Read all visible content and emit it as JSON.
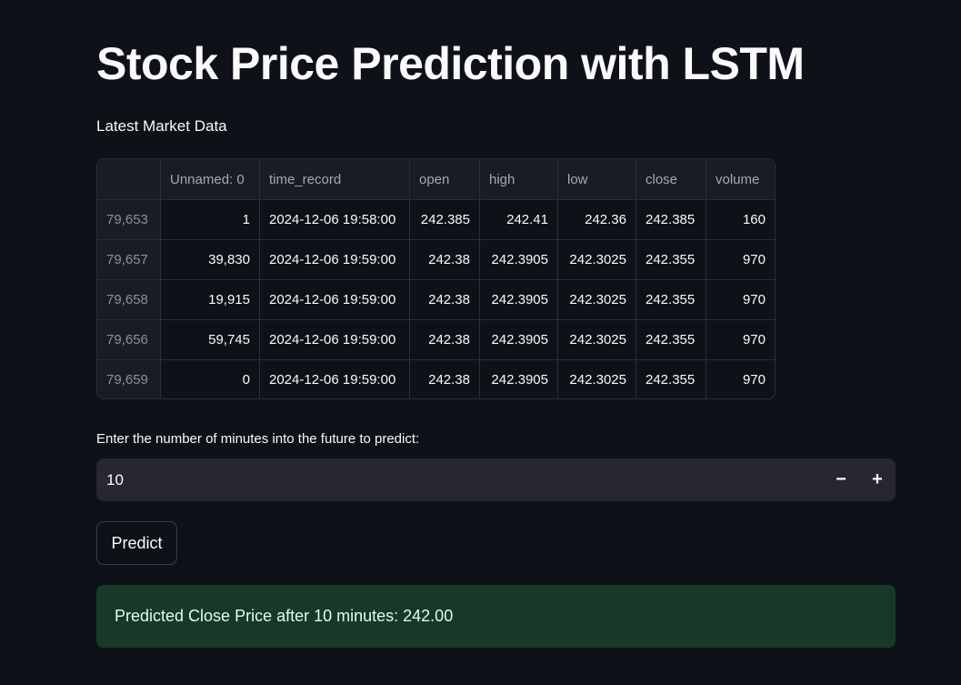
{
  "page": {
    "title": "Stock Price Prediction with LSTM",
    "subheading": "Latest Market Data"
  },
  "table": {
    "columns": [
      "",
      "Unnamed: 0",
      "time_record",
      "open",
      "high",
      "low",
      "close",
      "volume"
    ],
    "rows": [
      {
        "index": "79,653",
        "unnamed": "1",
        "time_record": "2024-12-06 19:58:00",
        "open": "242.385",
        "high": "242.41",
        "low": "242.36",
        "close": "242.385",
        "volume": "160"
      },
      {
        "index": "79,657",
        "unnamed": "39,830",
        "time_record": "2024-12-06 19:59:00",
        "open": "242.38",
        "high": "242.3905",
        "low": "242.3025",
        "close": "242.355",
        "volume": "970"
      },
      {
        "index": "79,658",
        "unnamed": "19,915",
        "time_record": "2024-12-06 19:59:00",
        "open": "242.38",
        "high": "242.3905",
        "low": "242.3025",
        "close": "242.355",
        "volume": "970"
      },
      {
        "index": "79,656",
        "unnamed": "59,745",
        "time_record": "2024-12-06 19:59:00",
        "open": "242.38",
        "high": "242.3905",
        "low": "242.3025",
        "close": "242.355",
        "volume": "970"
      },
      {
        "index": "79,659",
        "unnamed": "0",
        "time_record": "2024-12-06 19:59:00",
        "open": "242.38",
        "high": "242.3905",
        "low": "242.3025",
        "close": "242.355",
        "volume": "970"
      }
    ]
  },
  "input": {
    "label": "Enter the number of minutes into the future to predict:",
    "value": "10",
    "decrement_label": "−",
    "increment_label": "+"
  },
  "predict_button": {
    "label": "Predict"
  },
  "result": {
    "message": "Predicted Close Price after 10 minutes: 242.00"
  },
  "colors": {
    "background": "#0e1117",
    "input_background": "#262730",
    "success_background": "#173928",
    "success_text": "#dffde9"
  }
}
